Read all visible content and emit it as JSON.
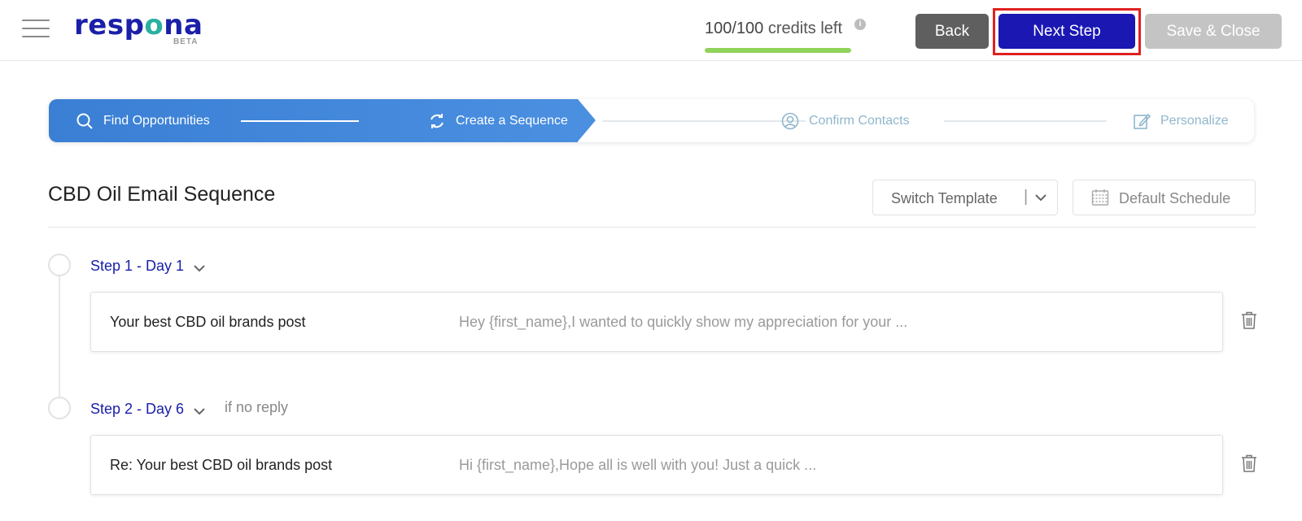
{
  "header": {
    "logo_main": "resp",
    "logo_o": "o",
    "logo_end": "na",
    "logo_beta": "BETA",
    "credits_num": "100/100",
    "credits_label": " credits left",
    "info_glyph": "i",
    "credits_fraction": 1.0,
    "back_label": "Back",
    "next_label": "Next Step",
    "save_label": "Save & Close"
  },
  "stepper": {
    "steps": [
      {
        "label": "Find Opportunities",
        "icon": "search-icon",
        "state": "done"
      },
      {
        "label": "Create a Sequence",
        "icon": "refresh-icon",
        "state": "active"
      },
      {
        "label": "Confirm Contacts",
        "icon": "user-icon",
        "state": "inactive"
      },
      {
        "label": "Personalize",
        "icon": "edit-icon",
        "state": "inactive"
      }
    ]
  },
  "sequence": {
    "title": "CBD Oil Email Sequence",
    "switch_template_label": "Switch Template",
    "switch_sep": "|",
    "default_schedule_label": "Default Schedule",
    "steps": [
      {
        "label": "Step 1 - Day 1",
        "condition": "",
        "subject": "Your best CBD oil brands post",
        "preview": "Hey {first_name},I wanted to quickly show my appreciation for your ..."
      },
      {
        "label": "Step 2 - Day 6",
        "condition": "if no reply",
        "subject": "Re: Your best CBD oil brands post",
        "preview": "Hi {first_name},Hope all is well with you! Just a quick ..."
      }
    ]
  },
  "colors": {
    "brand": "#1a20a8",
    "next_button": "#1a17b3",
    "active_step": "#4a8fe0",
    "credits_bar": "#8fd35a",
    "highlight": "#e02020"
  }
}
